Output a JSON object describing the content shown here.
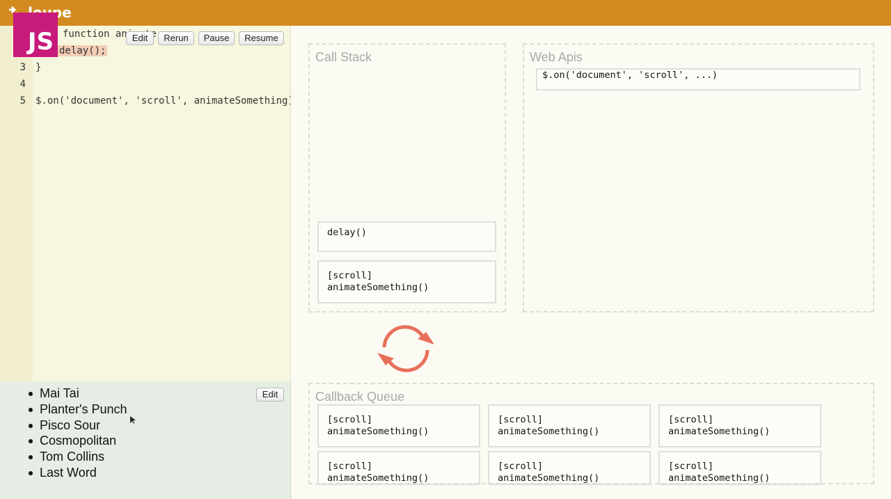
{
  "app": {
    "title": "loupe",
    "badge": "JS"
  },
  "editor": {
    "lines": [
      {
        "n": "",
        "text": "function animate",
        "pre": "",
        "hl": "",
        "post": ""
      },
      {
        "n": "",
        "text": "",
        "pre": "",
        "hl": "delay();",
        "post": ""
      },
      {
        "n": "3",
        "text": "}"
      },
      {
        "n": "4",
        "text": ""
      },
      {
        "n": "5",
        "text": "$.on('document', 'scroll', animateSomething)"
      }
    ],
    "buttons": {
      "edit": "Edit",
      "rerun": "Rerun",
      "pause": "Pause",
      "resume": "Resume"
    }
  },
  "rendered_list": {
    "edit_label": "Edit",
    "items": [
      "Mai Tai",
      "Planter's Punch",
      "Pisco Sour",
      "Cosmopolitan",
      "Tom Collins",
      "Last Word"
    ]
  },
  "call_stack": {
    "title": "Call Stack",
    "frames": [
      {
        "line1": "delay()",
        "line2": ""
      },
      {
        "line1": "[scroll]",
        "line2": "animateSomething()"
      }
    ]
  },
  "web_apis": {
    "title": "Web Apis",
    "items": [
      "$.on('document', 'scroll', ...)"
    ]
  },
  "callback_queue": {
    "title": "Callback Queue",
    "items": [
      {
        "line1": "[scroll]",
        "line2": "animateSomething()"
      },
      {
        "line1": "[scroll]",
        "line2": "animateSomething()"
      },
      {
        "line1": "[scroll]",
        "line2": "animateSomething()"
      },
      {
        "line1": "[scroll]",
        "line2": "animateSomething()"
      },
      {
        "line1": "[scroll]",
        "line2": "animateSomething()"
      },
      {
        "line1": "[scroll]",
        "line2": "animateSomething()"
      }
    ]
  },
  "colors": {
    "topbar": "#d38b1f",
    "badge": "#c81a7a",
    "loop": "#e8705a",
    "highlight": "#f4cdb6"
  }
}
